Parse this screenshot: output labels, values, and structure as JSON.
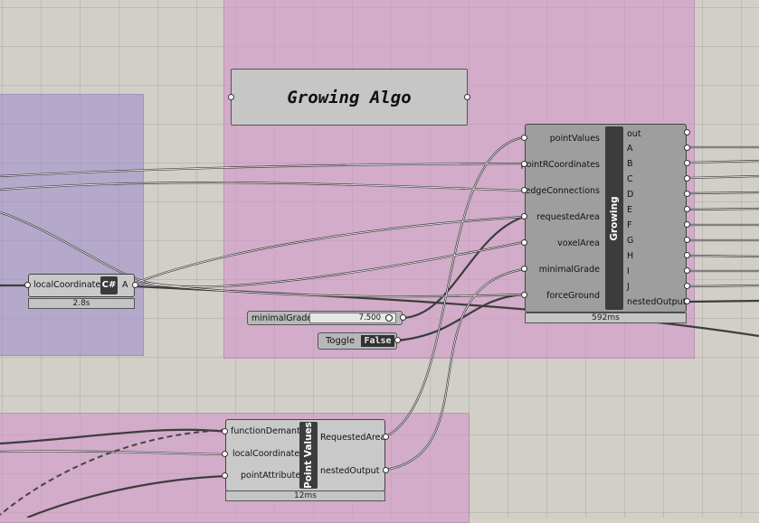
{
  "panel": {
    "text": "Growing Algo"
  },
  "local_component": {
    "input_label": "localCoordinates",
    "output_label": "A",
    "icon": "C#",
    "time": "2.8s"
  },
  "growing_component": {
    "title": "Growing",
    "inputs": [
      "pointValues",
      "pointRCoordinates",
      "edgeConnections",
      "requestedArea",
      "voxelArea",
      "minimalGrade",
      "forceGround"
    ],
    "outputs": [
      "out",
      "A",
      "B",
      "C",
      "D",
      "E",
      "F",
      "G",
      "H",
      "I",
      "J",
      "nestedOutput"
    ],
    "time": "592ms"
  },
  "slider": {
    "label": "minimalGrade",
    "value": "7.500"
  },
  "toggle": {
    "label": "Toggle",
    "value": "False"
  },
  "point_values_component": {
    "title": "Point Values",
    "inputs": [
      "functionDemants",
      "localCoordinates",
      "pointAttribute"
    ],
    "outputs": [
      "RequestedArea",
      "nestedOutput"
    ],
    "time": "12ms"
  },
  "colors": {
    "canvas": "#d2cfc8",
    "group_purple": "#b1a7c9",
    "group_pink": "#cfaac9",
    "component": "#9e9e9e",
    "wire": "#444444"
  }
}
